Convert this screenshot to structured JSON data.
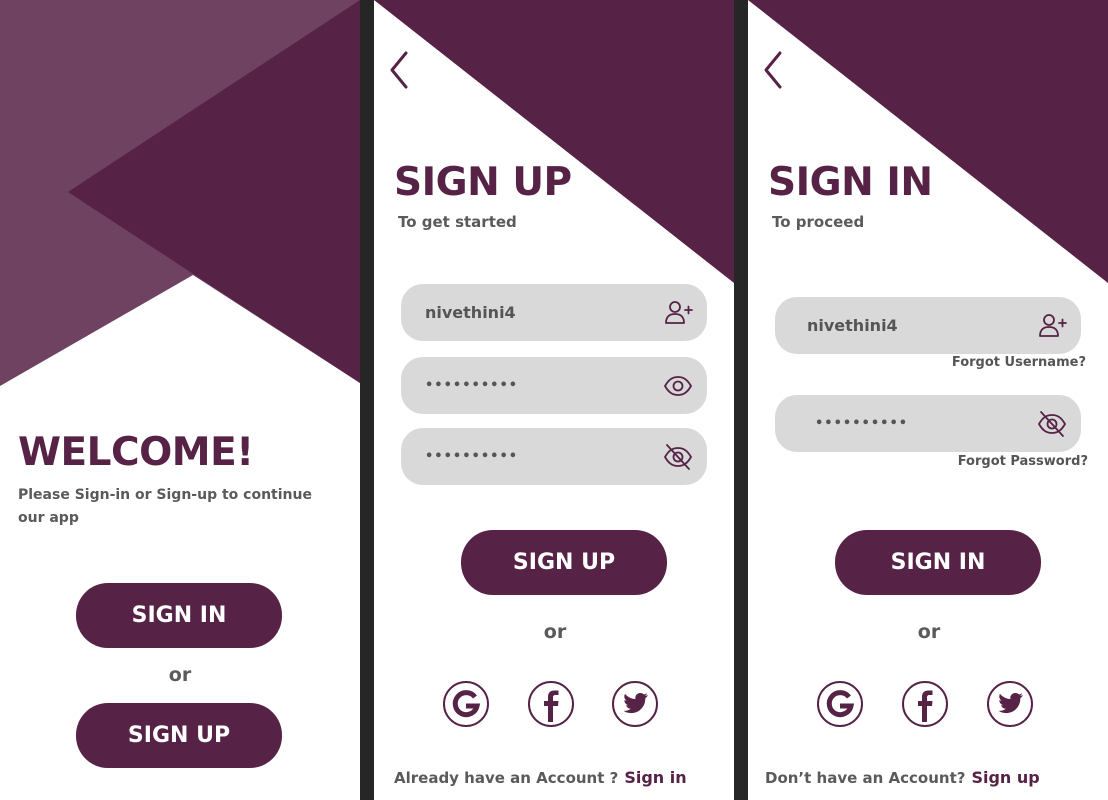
{
  "colors": {
    "primary": "#562246",
    "light_purple": "#6e4260",
    "field_bg": "#d9d9d9",
    "divider": "#262626"
  },
  "welcome": {
    "title": "WELCOME!",
    "description": "Please Sign-in or Sign-up to continue our app",
    "sign_in_label": "SIGN IN",
    "or_label": "or",
    "sign_up_label": "SIGN UP"
  },
  "signup": {
    "title": "SIGN UP",
    "subtitle": "To get started",
    "username_value": "nivethini4",
    "password_value": "••••••••••",
    "confirm_value": "••••••••••",
    "button_label": "SIGN UP",
    "or_label": "or",
    "social_icons": [
      "google-icon",
      "facebook-icon",
      "twitter-icon"
    ],
    "footer_question": "Already have an Account ?",
    "footer_link": "Sign in"
  },
  "signin": {
    "title": "SIGN IN",
    "subtitle": "To proceed",
    "username_value": "nivethini4",
    "forgot_username": "Forgot Username?",
    "password_value": "••••••••••",
    "forgot_password": "Forgot Password?",
    "button_label": "SIGN IN",
    "or_label": "or",
    "social_icons": [
      "google-icon",
      "facebook-icon",
      "twitter-icon"
    ],
    "footer_question": "Don’t have an Account?",
    "footer_link": "Sign up"
  }
}
